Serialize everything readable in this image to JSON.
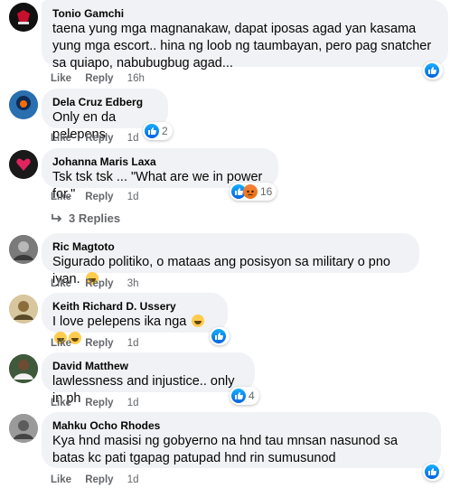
{
  "comments": [
    {
      "author": "Tonio Gamchi",
      "text": "taena yung mga magnanakaw, dapat iposas agad yan kasama yung mga escort.. hina ng loob ng taumbayan, pero pag snatcher sa quiapo, nabubugbug agad...",
      "like": "Like",
      "reply": "Reply",
      "time": "16h",
      "reactions": [
        "like"
      ],
      "count": ""
    },
    {
      "author": "Dela Cruz Edberg",
      "text": "Only en da pelepens",
      "like": "Like",
      "reply": "Reply",
      "time": "1d",
      "reactions": [
        "like"
      ],
      "count": "2"
    },
    {
      "author": "Johanna Maris Laxa",
      "text": "Tsk tsk tsk ... \"What are we in power for.\"",
      "like": "Like",
      "reply": "Reply",
      "time": "1d",
      "reactions": [
        "like",
        "angry"
      ],
      "count": "16"
    },
    {
      "author": "Ric Magtoto",
      "text": "Sigurado politiko, o mataas ang posisyon sa military o pno iyan.",
      "like": "Like",
      "reply": "Reply",
      "time": "3h",
      "reactions": [],
      "count": ""
    },
    {
      "author": "Keith Richard D. Ussery",
      "text": "I love pelepens ika nga",
      "like": "Like",
      "reply": "Reply",
      "time": "1d",
      "reactions": [
        "like"
      ],
      "count": ""
    },
    {
      "author": "David Matthew",
      "text": "lawlessness and injustice.. only in ph",
      "like": "Like",
      "reply": "Reply",
      "time": "1d",
      "reactions": [
        "like"
      ],
      "count": "4"
    },
    {
      "author": "Mahku Ocho Rhodes",
      "text": "Kya hnd masisi ng gobyerno na hnd tau mnsan nasunod sa batas kc pati tgapag patupad hnd rin sumusunod",
      "like": "Like",
      "reply": "Reply",
      "time": "1d",
      "reactions": [
        "like"
      ],
      "count": ""
    }
  ],
  "replies_label": "3 Replies",
  "colors": {
    "like_blue": "#1877f2",
    "angry_orange": "#f0731d",
    "bubble_bg": "#f0f2f5",
    "meta_gray": "#65676b"
  }
}
